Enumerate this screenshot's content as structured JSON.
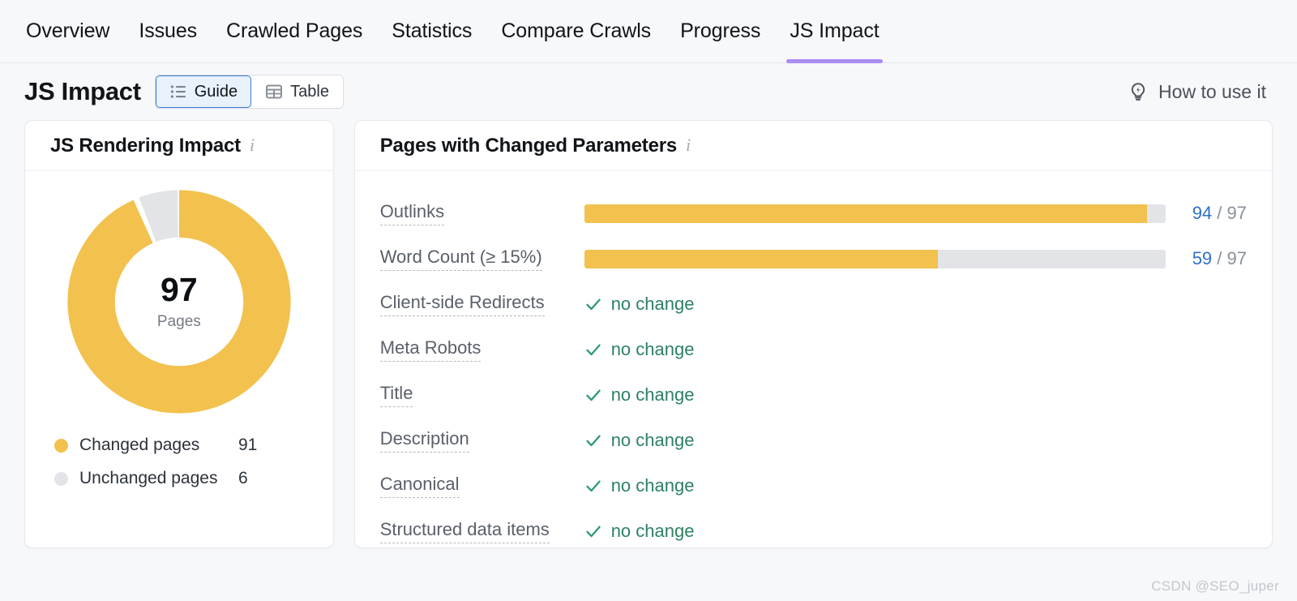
{
  "tabs": [
    {
      "label": "Overview",
      "active": false
    },
    {
      "label": "Issues",
      "active": false
    },
    {
      "label": "Crawled Pages",
      "active": false
    },
    {
      "label": "Statistics",
      "active": false
    },
    {
      "label": "Compare Crawls",
      "active": false
    },
    {
      "label": "Progress",
      "active": false
    },
    {
      "label": "JS Impact",
      "active": true
    }
  ],
  "header": {
    "title": "JS Impact",
    "view_toggle": [
      {
        "label": "Guide",
        "icon": "list-icon",
        "active": true
      },
      {
        "label": "Table",
        "icon": "table-icon",
        "active": false
      }
    ],
    "help_link": "How to use it",
    "help_icon": "lightbulb-icon"
  },
  "rendering_card": {
    "title": "JS Rendering Impact",
    "info_icon": "info-icon",
    "center_value": "97",
    "center_label": "Pages",
    "legend": [
      {
        "label": "Changed pages",
        "value": "91",
        "color": "#f2c14e"
      },
      {
        "label": "Unchanged pages",
        "value": "6",
        "color": "#e2e4e8"
      }
    ]
  },
  "params_card": {
    "title": "Pages with Changed Parameters",
    "info_icon": "info-icon",
    "total": "97",
    "separator": "/",
    "no_change_text": "no change",
    "rows": [
      {
        "label": "Outlinks",
        "type": "bar",
        "value": "94",
        "total": "97",
        "percent": 96.9
      },
      {
        "label": "Word Count (≥ 15%)",
        "type": "bar",
        "value": "59",
        "total": "97",
        "percent": 60.8
      },
      {
        "label": "Client-side Redirects",
        "type": "no-change",
        "value": "no change"
      },
      {
        "label": "Meta Robots",
        "type": "no-change",
        "value": "no change"
      },
      {
        "label": "Title",
        "type": "no-change",
        "value": "no change"
      },
      {
        "label": "Description",
        "type": "no-change",
        "value": "no change"
      },
      {
        "label": "Canonical",
        "type": "no-change",
        "value": "no change"
      },
      {
        "label": "Structured data items",
        "type": "no-change",
        "value": "no change"
      }
    ]
  },
  "chart_data": {
    "type": "pie",
    "title": "JS Rendering Impact",
    "labels": [
      "Changed pages",
      "Unchanged pages"
    ],
    "values": [
      91,
      6
    ],
    "colors": [
      "#f2c14e",
      "#e2e4e8"
    ],
    "total": 97,
    "center_text": "97 Pages",
    "legend_position": "bottom-left"
  },
  "colors": {
    "accent_yellow": "#f2c14e",
    "track_gray": "#e2e4e8",
    "link_blue": "#2f6fc9",
    "success_green": "#2e8162",
    "tab_active_purple": "#ab8df0",
    "page_bg": "#f7f8fa"
  },
  "watermark": "CSDN @SEO_juper"
}
